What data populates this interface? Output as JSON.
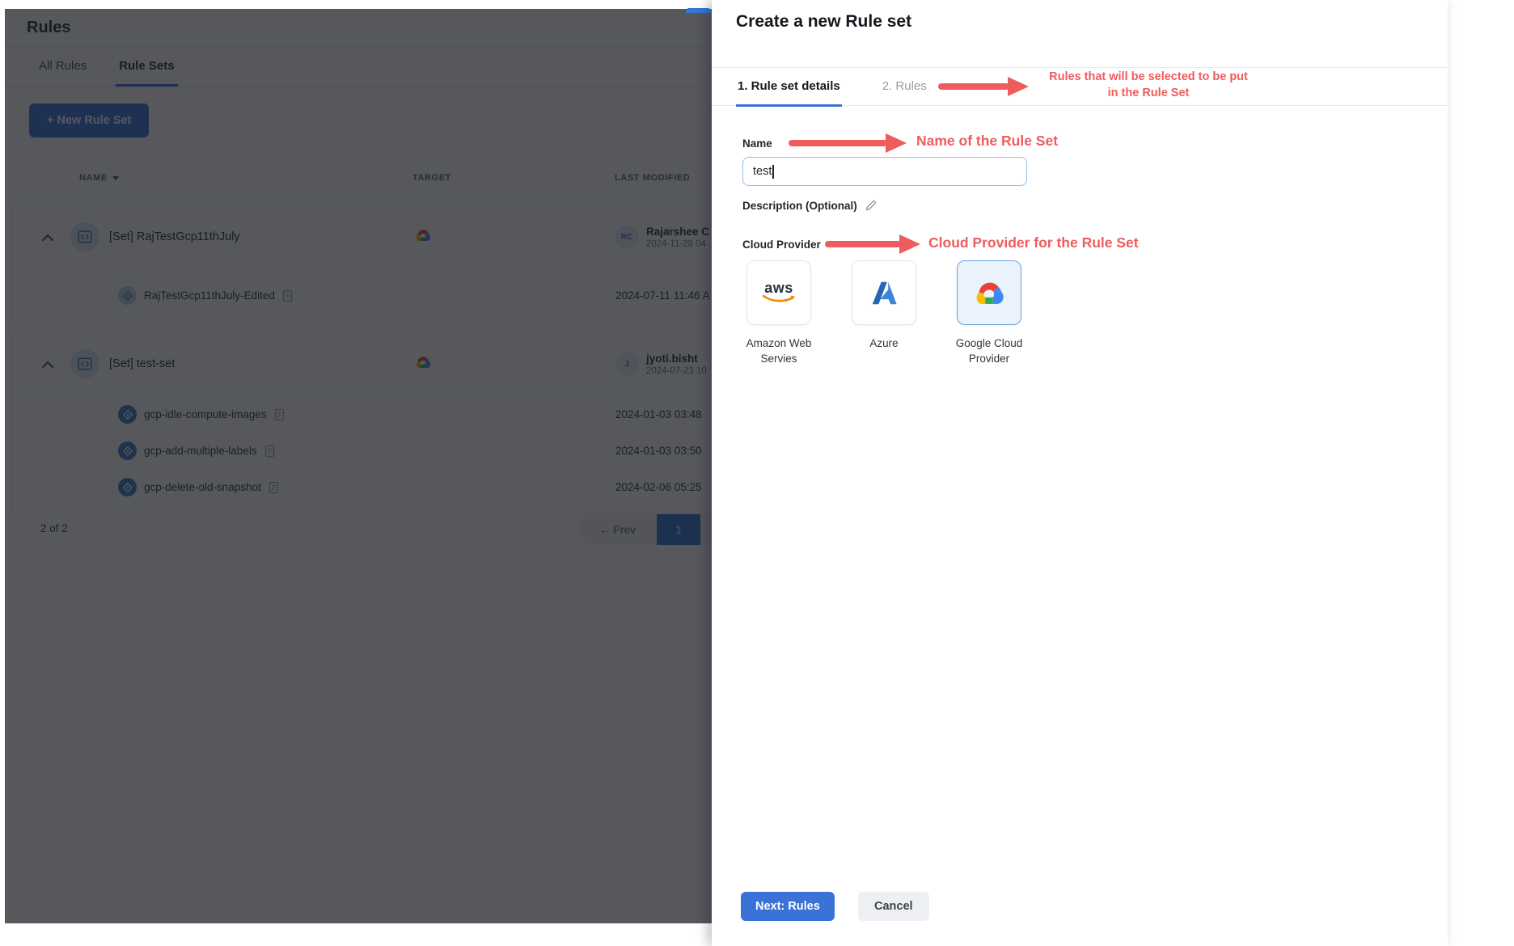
{
  "page": {
    "title": "Rules",
    "tabs": [
      {
        "label": "All Rules",
        "active": false
      },
      {
        "label": "Rule Sets",
        "active": true
      }
    ],
    "new_button": "+ New Rule Set",
    "table": {
      "columns": [
        "NAME",
        "TARGET",
        "LAST MODIFIED"
      ],
      "groups": [
        {
          "name": "[Set] RajTestGcp11thJuly",
          "target": "gcp-icon",
          "initials": "RC",
          "modified_by": "Rajarshee C",
          "modified_date": "2024-11-28 04",
          "children": [
            {
              "name": "RajTestGcp11thJuly-Edited",
              "modified": "2024-07-11 11:46 A"
            }
          ]
        },
        {
          "name": "[Set] test-set",
          "target": "gcp-icon",
          "initials": "J",
          "modified_by": "jyoti.bisht",
          "modified_date": "2024-07-23 10",
          "children": [
            {
              "name": "gcp-idle-compute-images",
              "modified": "2024-01-03 03:48"
            },
            {
              "name": "gcp-add-multiple-labels",
              "modified": "2024-01-03 03:50"
            },
            {
              "name": "gcp-delete-old-snapshot",
              "modified": "2024-02-06 05:25"
            }
          ]
        }
      ]
    },
    "pagination": {
      "summary": "2 of 2",
      "prev": "← Prev",
      "page": "1"
    }
  },
  "drawer": {
    "title": "Create a new Rule set",
    "steps": [
      {
        "label": "1. Rule set details",
        "active": true
      },
      {
        "label": "2. Rules",
        "active": false
      }
    ],
    "name_label": "Name",
    "name_value": "test",
    "description_label": "Description (Optional)",
    "cloud_label": "Cloud Provider",
    "providers": [
      {
        "label": "Amazon Web Servies",
        "logo_text": "aws",
        "selected": false
      },
      {
        "label": "Azure",
        "selected": false
      },
      {
        "label": "Google Cloud Provider",
        "selected": true
      }
    ],
    "next_label": "Next: Rules",
    "cancel_label": "Cancel"
  },
  "annotations": {
    "steps_line1": "Rules that will be selected to be put",
    "steps_line2": "in the Rule Set",
    "name_note": "Name of the Rule Set",
    "provider_note": "Cloud Provider for the Rule Set"
  },
  "colors": {
    "accent_blue": "#3873d9",
    "annotation_red": "#ee5c5c",
    "selected_card_border": "#6f9fd8",
    "selected_card_bg": "#eaf3fb",
    "overlay": "rgba(21,24,29,0.72)"
  }
}
